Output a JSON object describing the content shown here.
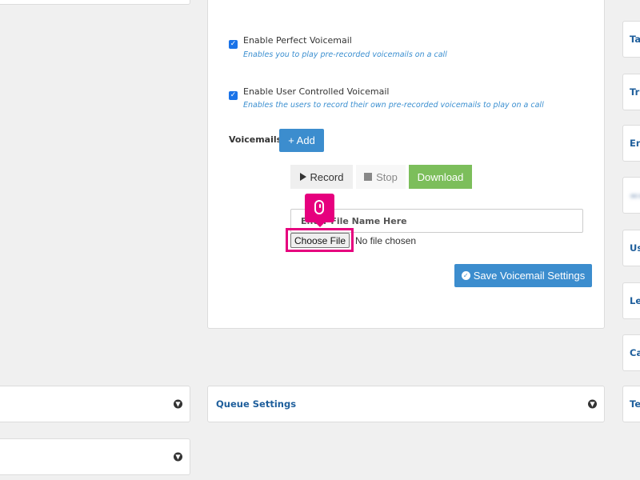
{
  "voicemail_panel": {
    "perfect_voicemail": {
      "checked": true,
      "label": "Enable Perfect Voicemail",
      "description": "Enables you to play pre-recorded voicemails on a call"
    },
    "user_controlled_voicemail": {
      "checked": true,
      "label": "Enable User Controlled Voicemail",
      "description": "Enables the users to record their own pre-recorded voicemails to play on a call"
    },
    "voicemails_label": "Voicemails",
    "add_button": "+ Add",
    "record_button": "Record",
    "stop_button": "Stop",
    "download_button": "Download",
    "file_name_placeholder": "Enter File Name Here",
    "choose_file_button": "Choose File",
    "file_status": "No file chosen",
    "save_button": "Save Voicemail Settings"
  },
  "queue_settings": {
    "title": "Queue Settings"
  },
  "right_sidebar": {
    "items": [
      "Ta",
      "Tr",
      "En",
      "",
      "Us",
      "Le",
      "Ca",
      "Te"
    ]
  },
  "icons": {
    "checkbox": "checkmark-icon",
    "play": "play-icon",
    "stop": "stop-icon",
    "save": "check-circle-icon",
    "chevron": "chevron-down-circle-icon",
    "cursor": "mouse-click-icon"
  },
  "colors": {
    "accent_blue": "#3c8dce",
    "download_green": "#7cbe5b",
    "highlight_pink": "#e6007e",
    "description_blue": "#3b8fd0",
    "heading_blue": "#1f5f9c"
  }
}
